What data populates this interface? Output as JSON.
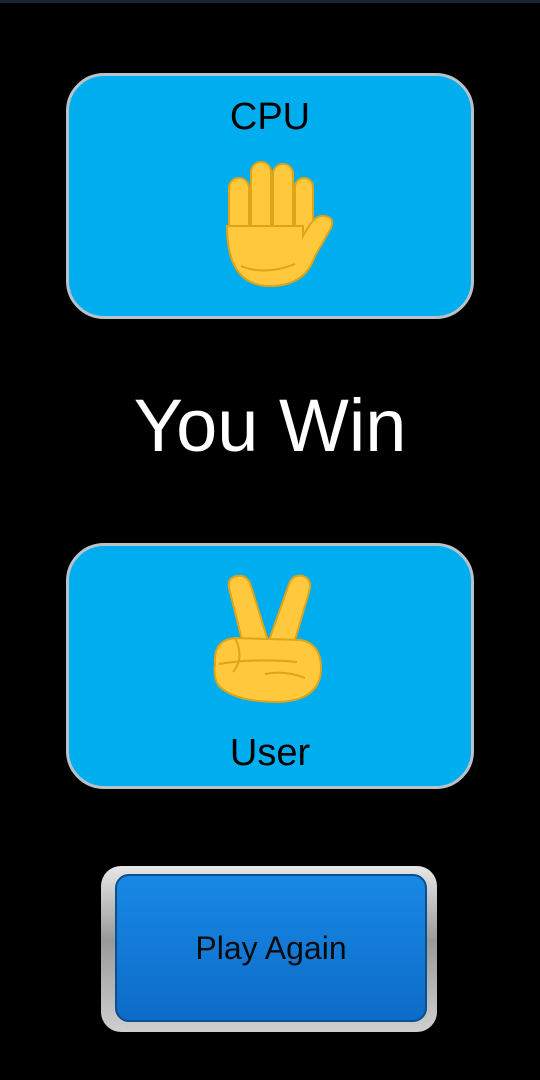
{
  "cpu": {
    "label": "CPU",
    "choice_icon": "raised-hand-icon"
  },
  "result": {
    "text": "You Win"
  },
  "user": {
    "label": "User",
    "choice_icon": "victory-hand-icon"
  },
  "actions": {
    "play_again_label": "Play Again"
  },
  "colors": {
    "background": "#000000",
    "card": "#00aeef",
    "card_border": "#b9c2c9",
    "button": "#1888e5",
    "hand": "#ffc83d",
    "result_text": "#ffffff"
  }
}
